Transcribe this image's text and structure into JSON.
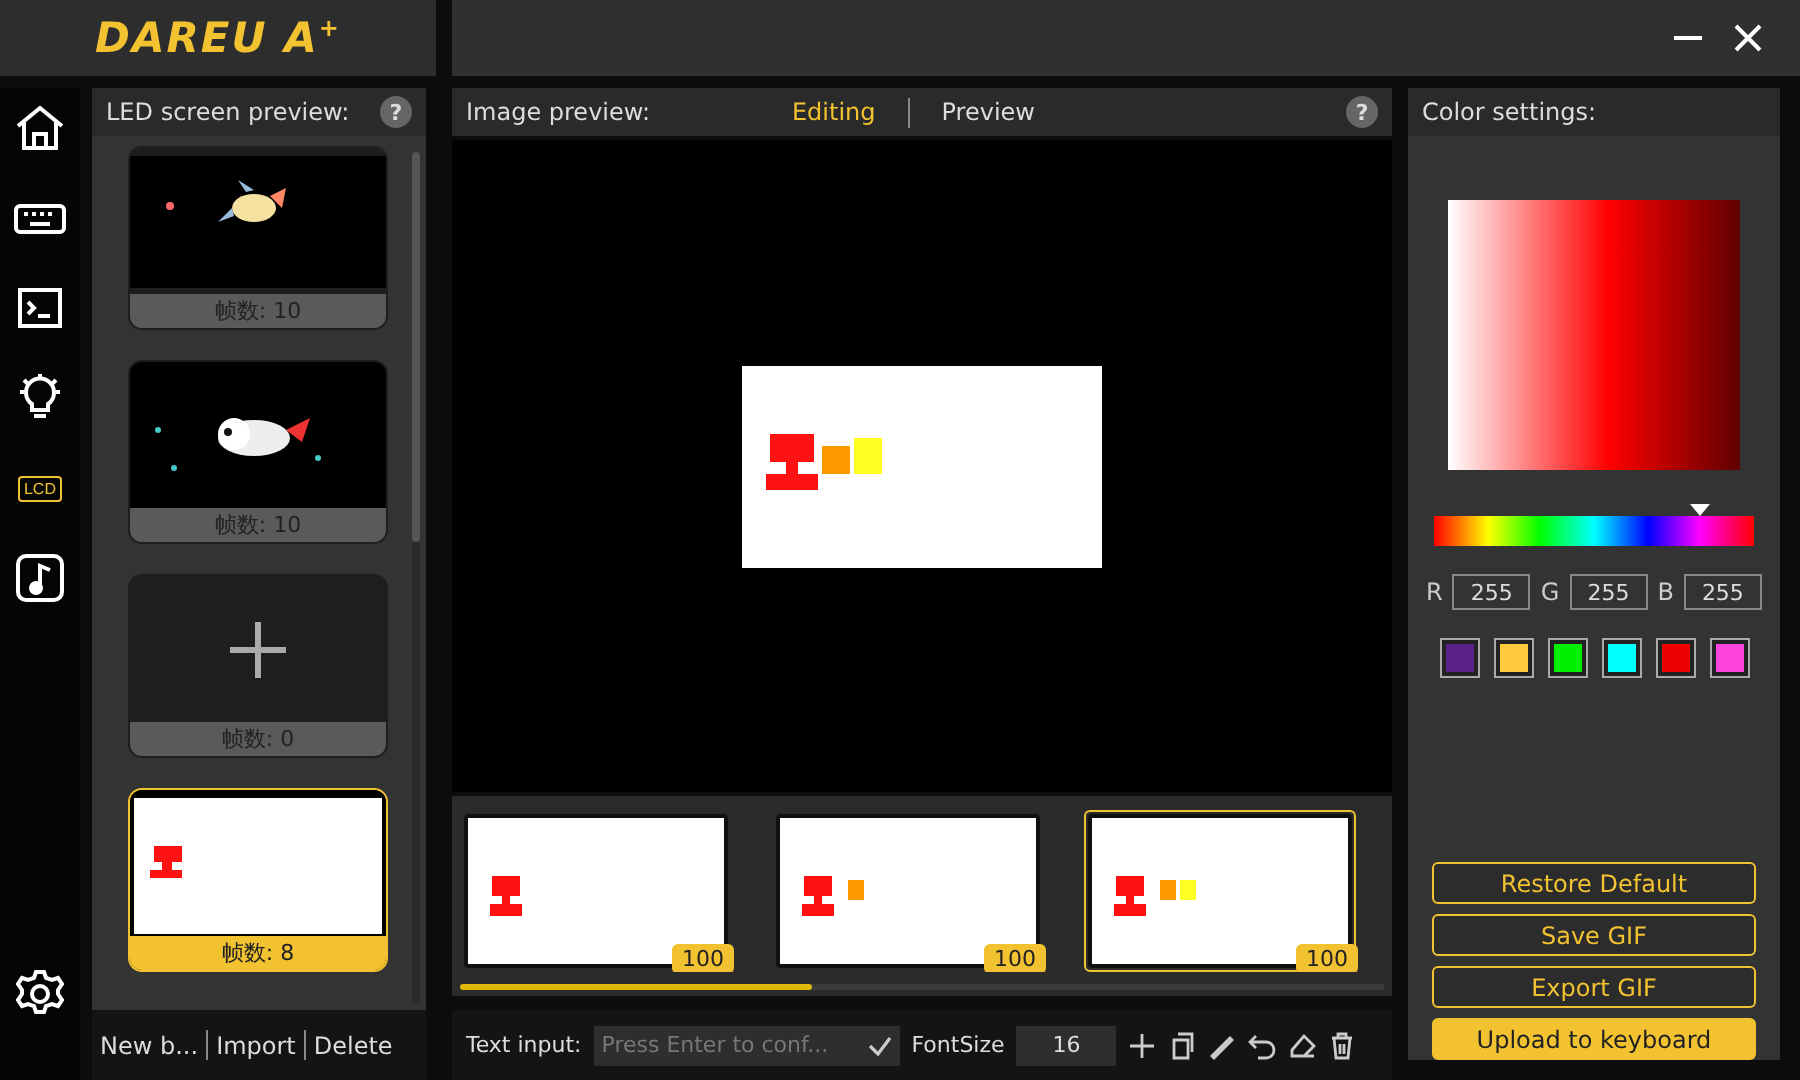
{
  "logo": "DAREU A$^{+}$",
  "nav": [
    {
      "selected": false
    },
    {
      "selected": false
    },
    {
      "selected": false
    },
    {
      "selected": false
    },
    {
      "label": "LCD",
      "selected": true
    },
    {
      "selected": false
    }
  ],
  "led_panel": {
    "title": "LED screen preview:",
    "help": "?",
    "cards": [
      {
        "kind": "rocket",
        "count": "帧数: 10",
        "selected": false
      },
      {
        "kind": "panda",
        "count": "帧数: 10",
        "selected": false
      },
      {
        "kind": "add",
        "count": "帧数: 0",
        "selected": false
      },
      {
        "kind": "white",
        "count": "帧数: 8",
        "selected": true
      }
    ],
    "actions": [
      "New b...",
      "Import",
      "Delete"
    ]
  },
  "image_panel": {
    "title": "Image preview:",
    "help": "?",
    "tabs": [
      {
        "label": "Editing",
        "selected": true
      },
      {
        "label": "Preview",
        "selected": false
      }
    ],
    "frames": [
      {
        "duration": "100",
        "selected": false
      },
      {
        "duration": "100",
        "selected": false
      },
      {
        "duration": "100",
        "selected": true
      }
    ],
    "progress": {
      "level": 0.38
    },
    "toolbar": {
      "text_label": "Text input:",
      "text_placeholder": "Press Enter to conf...",
      "font_label": "FontSize",
      "font_size": "16"
    }
  },
  "color_panel": {
    "title": "Color settings:",
    "hue": {
      "level": 0.83
    },
    "rgb": [
      {
        "label": "R",
        "value": "255"
      },
      {
        "label": "G",
        "value": "255"
      },
      {
        "label": "B",
        "value": "255"
      }
    ],
    "swatches": [
      {
        "color": "#5b2089"
      },
      {
        "color": "#ffc83d"
      },
      {
        "color": "#00ee00"
      },
      {
        "color": "#00ffff"
      },
      {
        "color": "#ee0000"
      },
      {
        "color": "#ff44dd"
      }
    ],
    "buttons": [
      {
        "label": "Restore Default",
        "kind": "outline"
      },
      {
        "label": "Save GIF",
        "kind": "outline"
      },
      {
        "label": "Export GIF",
        "kind": "outline"
      },
      {
        "label": "Upload to keyboard",
        "kind": "primary"
      }
    ]
  }
}
